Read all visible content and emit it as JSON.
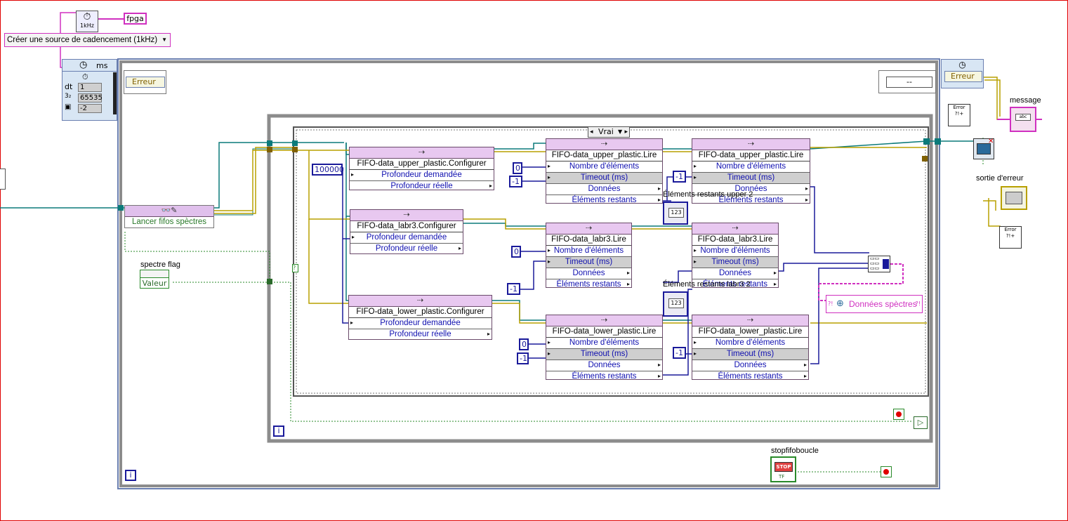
{
  "fpga_label": "fpga",
  "timer_source": "Créer une source de cadencement (1kHz)",
  "timer_icon_text": "1kHz",
  "timed_loop": {
    "unit": "ms",
    "dt_label": "dt",
    "dt_value": "1",
    "pri_value": "65535",
    "core_value": "-2"
  },
  "erreur_left": "Erreur",
  "erreur_right": "Erreur",
  "dash_value": "--",
  "message_label": "message",
  "abc_text": "abc",
  "sortie_erreur_label": "sortie d'erreur",
  "lancer_fifos": "Lancer fifos spèctres",
  "spectre_flag": {
    "label": "spectre flag",
    "value": "Valeur"
  },
  "case_selector": "Vrai",
  "const_100000": "100000",
  "configure_nodes": [
    {
      "title": "FIFO-data_upper_plastic.Configurer",
      "rows": [
        "Profondeur demandée",
        "Profondeur réelle"
      ]
    },
    {
      "title": "FIFO-data_labr3.Configurer",
      "rows": [
        "Profondeur demandée",
        "Profondeur réelle"
      ]
    },
    {
      "title": "FIFO-data_lower_plastic.Configurer",
      "rows": [
        "Profondeur demandée",
        "Profondeur réelle"
      ]
    }
  ],
  "read_nodes": [
    {
      "title": "FIFO-data_upper_plastic.Lire",
      "rows": [
        "Nombre d'éléments",
        "Timeout (ms)",
        "Données",
        "Éléments restants"
      ]
    },
    {
      "title": "FIFO-data_upper_plastic.Lire",
      "rows": [
        "Nombre d'éléments",
        "Timeout (ms)",
        "Données",
        "Éléments restants"
      ]
    },
    {
      "title": "FIFO-data_labr3.Lire",
      "rows": [
        "Nombre d'éléments",
        "Timeout (ms)",
        "Données",
        "Éléments restants"
      ]
    },
    {
      "title": "FIFO-data_labr3.Lire",
      "rows": [
        "Nombre d'éléments",
        "Timeout (ms)",
        "Données",
        "Éléments restants"
      ]
    },
    {
      "title": "FIFO-data_lower_plastic.Lire",
      "rows": [
        "Nombre d'éléments",
        "Timeout (ms)",
        "Données",
        "Éléments restants"
      ]
    },
    {
      "title": "FIFO-data_lower_plastic.Lire",
      "rows": [
        "Nombre d'éléments",
        "Timeout (ms)",
        "Données",
        "Éléments restants"
      ]
    }
  ],
  "consts": {
    "c0a": "0",
    "cm1a": "-1",
    "cm1b": "-1",
    "c0b": "0",
    "cm1c": "-1",
    "cm1d": "-1",
    "c0c": "0",
    "cm1e": "-1",
    "cm1f": "-1"
  },
  "elements_upper": "Éléments restants upper 2",
  "elements_labr3": "Éléments restants labr3 2",
  "indicator_123": "123",
  "donnees_spectres": "Données spèctres",
  "stopfifoboucle": "stopfifoboucle",
  "stop_text": "STOP",
  "tf_text": "TF",
  "loop_index": "i",
  "error_glyph": "Error",
  "colors": {
    "frame": "#e00000",
    "loop_border": "#8c8c8c",
    "wire_error": "#b8a000",
    "wire_int": "#1a1a9a",
    "wire_ref": "#0b7a7a",
    "wire_bool": "#2a8a2a",
    "node_header": "#e8c8f0",
    "string_pink": "#d030c0"
  }
}
